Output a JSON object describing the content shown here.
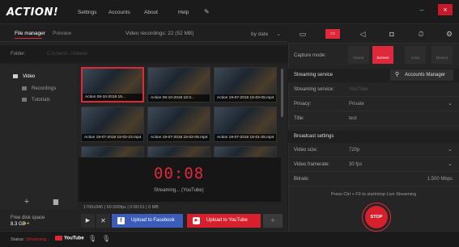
{
  "app": {
    "logo": "ACTION!"
  },
  "menu": [
    "Settings",
    "Accounts",
    "About",
    "Help"
  ],
  "window_controls": {
    "minimize": "–",
    "close": "×"
  },
  "left": {
    "tabs": {
      "file_manager": "File manager",
      "preview": "Preview"
    },
    "recordings_count": "Video recordings: 22 (52 MB)",
    "sort_by": "by date",
    "folder_label": "Folder:",
    "folder_path": "C:\\Users\\...\\Videos",
    "tree": [
      {
        "label": "Video"
      },
      {
        "label": "Recordings"
      },
      {
        "label": "Tutorials"
      }
    ],
    "thumbnails": [
      "Action 08-10-2018 16...",
      "Action 08-10-2018 16:3...",
      "Action 19-07-2018 15-03-05.mp4",
      "Action 19-07-2018 15-02-23.mp4",
      "Action 19-07-2018 15-02-05.mp4",
      "Action 19-07-2018 15-01-25.mp4"
    ],
    "timer": "00:08",
    "streaming_status": "Streaming... (YouTube)",
    "file_info": "1700x946 | 60.000fps | 0:00:01 | 0 MB",
    "free_disk_label": "Free disk space",
    "free_disk_value": "8.3 GB",
    "upload_facebook": "Upload to Facebook",
    "upload_youtube": "Upload to YouTube"
  },
  "status": {
    "label": "Status:",
    "value": "Streaming...",
    "service": "YouTube"
  },
  "right": {
    "capture_mode_label": "Capture mode:",
    "capture_modes": [
      "Game",
      "Screen",
      "Area",
      "Device"
    ],
    "streaming_section": "Streaming service",
    "accounts_button": "Accounts Manager",
    "rows": [
      {
        "label": "Streaming service:",
        "value": "YouTube"
      },
      {
        "label": "Privacy:",
        "value": "Private"
      },
      {
        "label": "Title:",
        "value": "test"
      }
    ],
    "broadcast_section": "Broadcast settings",
    "broadcast_rows": [
      {
        "label": "Video size:",
        "value": "720p"
      },
      {
        "label": "Video framerate:",
        "value": "30 fps"
      },
      {
        "label": "Bitrate:",
        "value": "1.500 Mbps"
      }
    ],
    "hint": "Press Ctrl + F9 to start/stop Live Streaming",
    "stop_label": "STOP"
  },
  "colors": {
    "accent": "#e0283b",
    "facebook": "#3b5cb8",
    "youtube": "#d6202e"
  }
}
